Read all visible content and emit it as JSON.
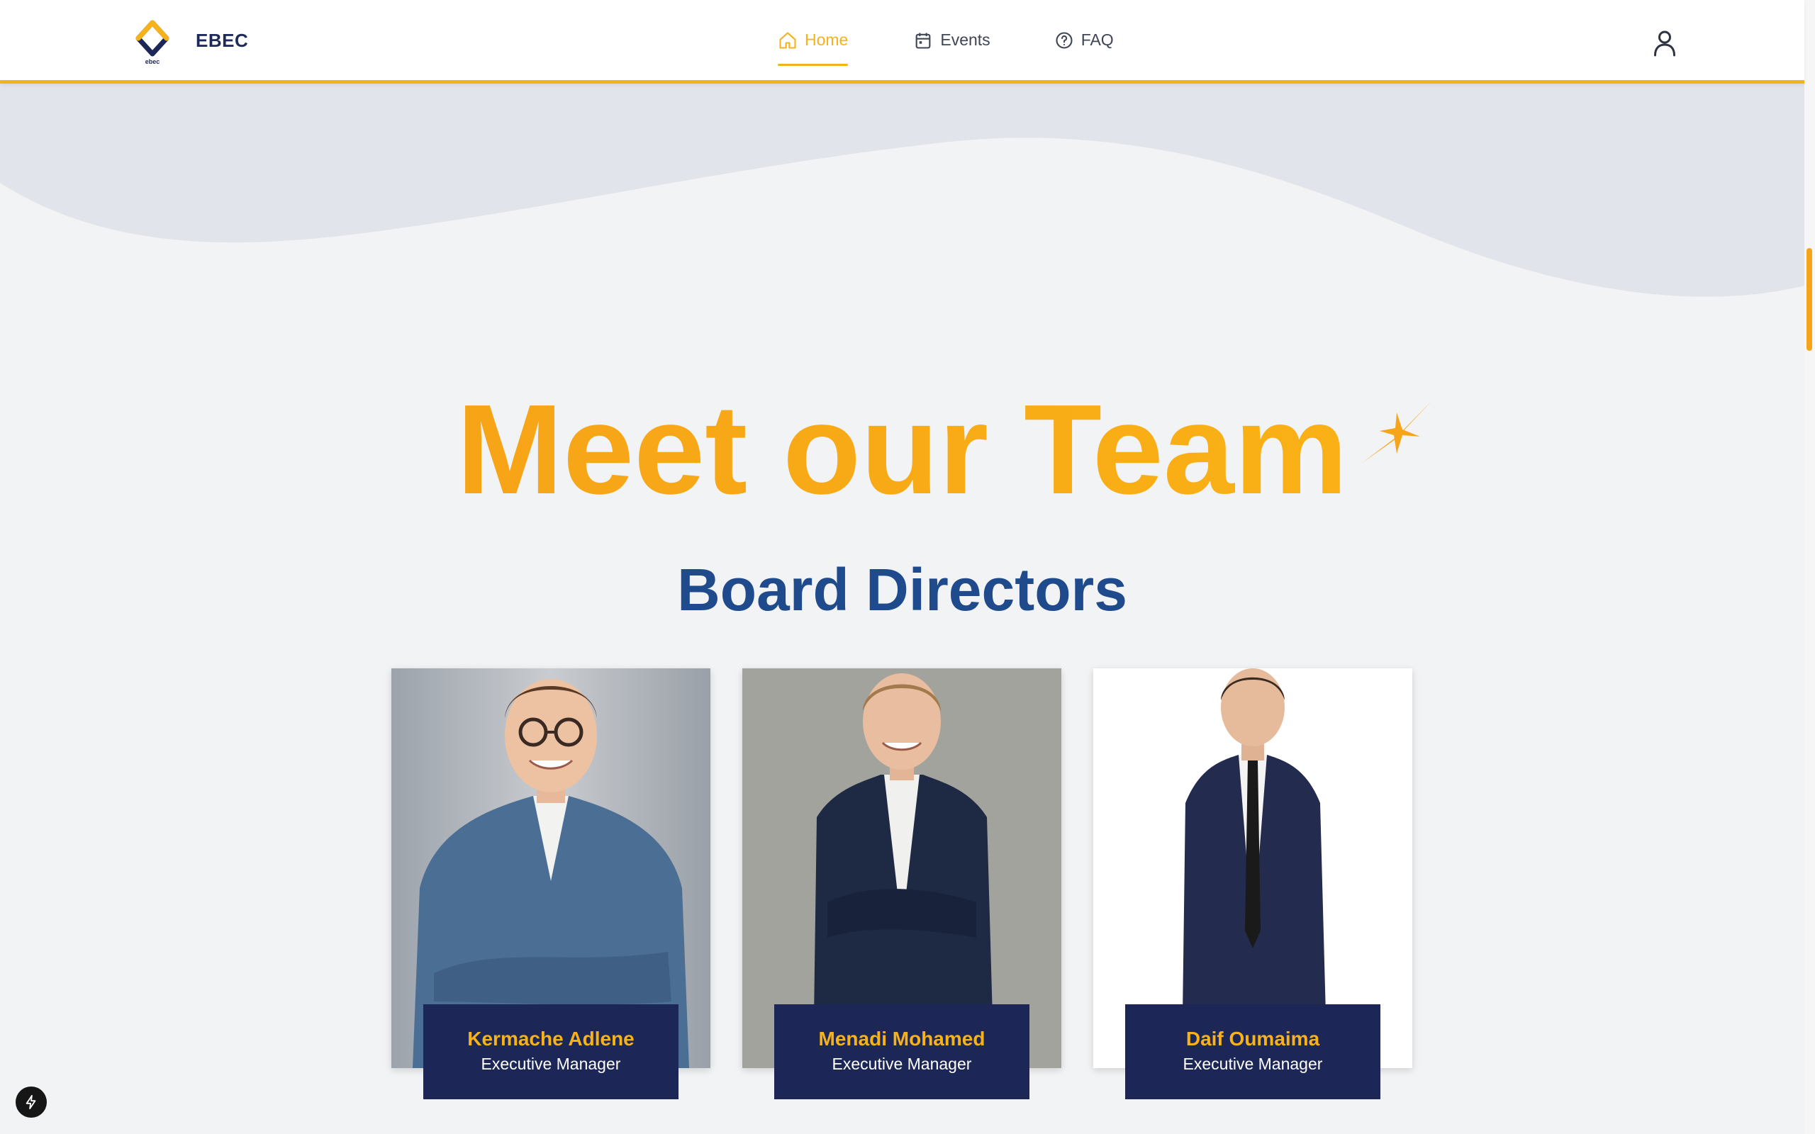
{
  "header": {
    "brand": "EBEC",
    "logo_caption": "ebec",
    "nav": [
      {
        "label": "Home",
        "icon": "home-icon",
        "active": true
      },
      {
        "label": "Events",
        "icon": "calendar-icon",
        "active": false
      },
      {
        "label": "FAQ",
        "icon": "help-circle-icon",
        "active": false
      }
    ],
    "user_icon": "user-icon"
  },
  "hero": {
    "title": "Meet our Team",
    "subtitle": "Board Directors"
  },
  "team": [
    {
      "name": "Kermache Adlene",
      "role": "Executive Manager"
    },
    {
      "name": "Menadi Mohamed",
      "role": "Executive Manager"
    },
    {
      "name": "Daif Oumaima",
      "role": "Executive Manager"
    }
  ],
  "colors": {
    "accent": "#f6b21b",
    "navy": "#1c2757",
    "subtitle_blue": "#1f4a8c",
    "background": "#f2f3f5"
  },
  "badge_icon": "lightning-icon"
}
